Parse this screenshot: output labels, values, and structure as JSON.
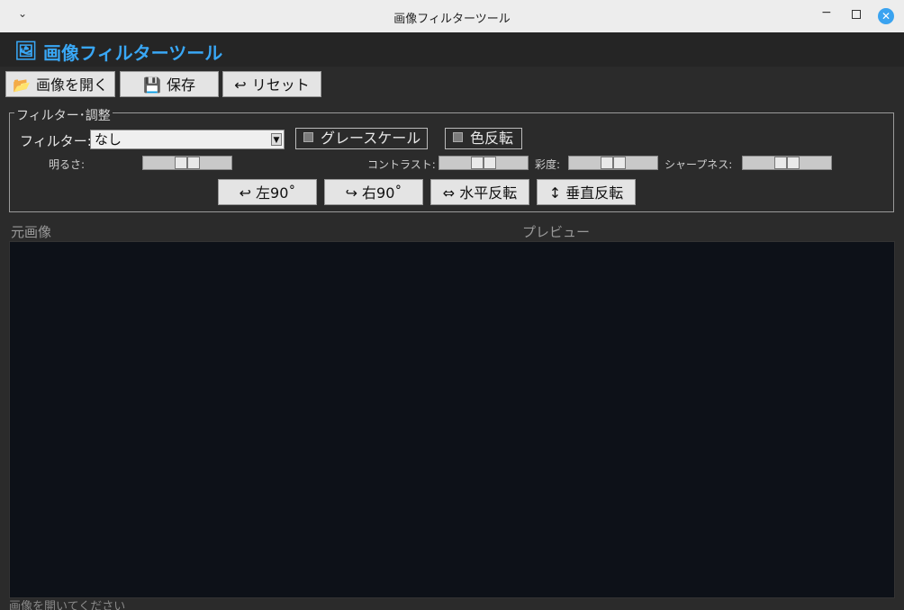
{
  "window": {
    "title": "画像フィルターツール",
    "chevron": "⌄",
    "minimize": "−",
    "close": "✕"
  },
  "header": {
    "logo_icon": "🖼",
    "title": "画像フィルターツール"
  },
  "toolbar": {
    "open": {
      "icon": "📂",
      "label": "画像を開く"
    },
    "save": {
      "icon": "💾",
      "label": "保存"
    },
    "reset": {
      "icon": "↩",
      "label": "リセット"
    }
  },
  "panel": {
    "legend": "フィルター･調整",
    "filter_label": "フィルター:",
    "filter_value": "なし",
    "grayscale_label": "グレースケール",
    "grayscale_checked": false,
    "invert_label": "色反転",
    "invert_checked": false,
    "brightness_label": "明るさ:",
    "contrast_label": "コントラスト:",
    "saturation_label": "彩度:",
    "sharpness_label": "シャープネス:",
    "rotate_left": "↩ 左90˚",
    "rotate_right": "↪ 右90˚",
    "flip_h": "⇔ 水平反転",
    "flip_v": "↕ 垂直反転"
  },
  "sliders": {
    "brightness": 0.5,
    "contrast": 0.5,
    "saturation": 0.5,
    "sharpness": 0.5
  },
  "view": {
    "original_label": "元画像",
    "preview_label": "プレビュー"
  },
  "status": {
    "text": "画像を開いてください"
  },
  "colors": {
    "accent": "#39a7f5",
    "background": "#2b2b2b",
    "canvas": "#0d1118"
  }
}
